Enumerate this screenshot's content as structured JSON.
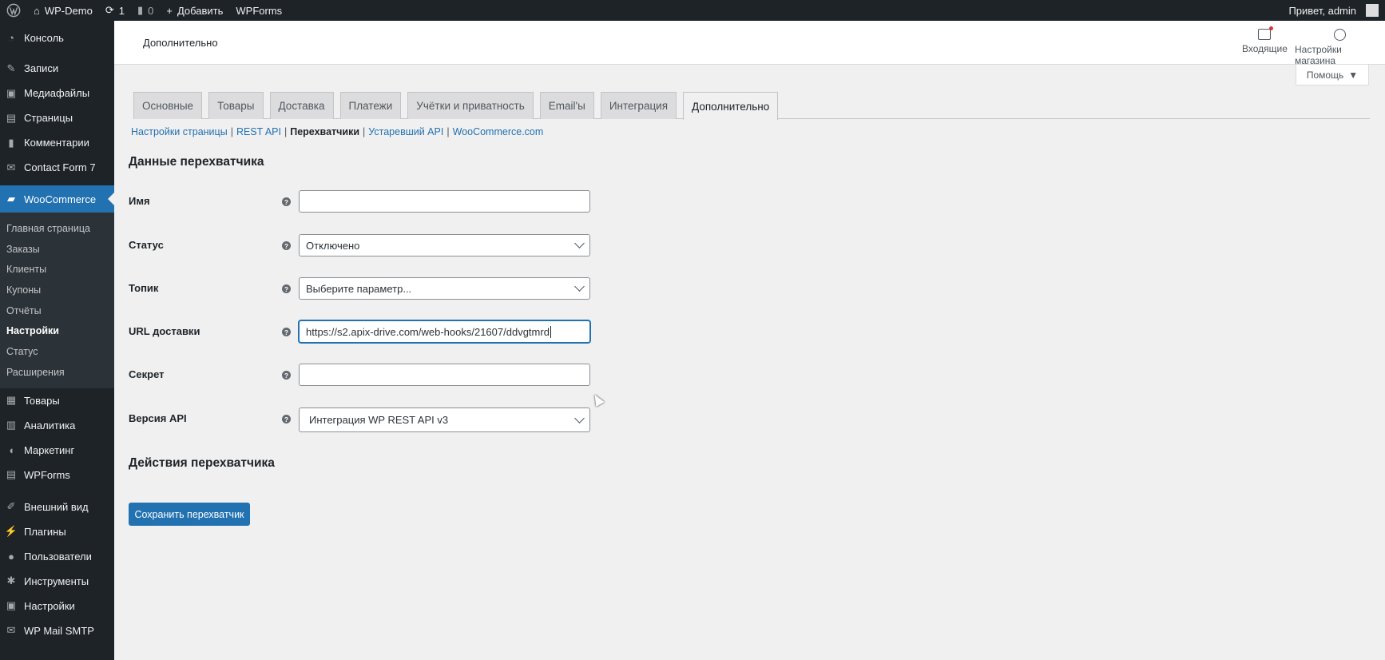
{
  "adminbar": {
    "site_name": "WP-Demo",
    "updates_count": "1",
    "comments_count": "0",
    "add_new": "Добавить",
    "wpforms": "WPForms",
    "greeting": "Привет, admin"
  },
  "sidebar": {
    "items_top": [
      {
        "label": "Консоль",
        "icon": "dashboard-icon"
      },
      {
        "label": "Записи",
        "icon": "pin-icon"
      },
      {
        "label": "Медиафайлы",
        "icon": "media-icon"
      },
      {
        "label": "Страницы",
        "icon": "page-icon"
      },
      {
        "label": "Комментарии",
        "icon": "comment-icon"
      },
      {
        "label": "Contact Form 7",
        "icon": "mail-icon"
      }
    ],
    "active": {
      "label": "WooCommerce",
      "icon": "woo-icon"
    },
    "submenu": [
      "Главная страница",
      "Заказы",
      "Клиенты",
      "Купоны",
      "Отчёты",
      "Настройки",
      "Статус",
      "Расширения"
    ],
    "submenu_current": "Настройки",
    "items_bottom": [
      {
        "label": "Товары",
        "icon": "products-icon"
      },
      {
        "label": "Аналитика",
        "icon": "analytics-icon"
      },
      {
        "label": "Маркетинг",
        "icon": "megaphone-icon"
      },
      {
        "label": "WPForms",
        "icon": "forms-icon"
      },
      {
        "label": "Внешний вид",
        "icon": "brush-icon"
      },
      {
        "label": "Плагины",
        "icon": "plugin-icon"
      },
      {
        "label": "Пользователи",
        "icon": "users-icon"
      },
      {
        "label": "Инструменты",
        "icon": "wrench-icon"
      },
      {
        "label": "Настройки",
        "icon": "settings-icon"
      },
      {
        "label": "WP Mail SMTP",
        "icon": "mail-smtp-icon"
      }
    ]
  },
  "header": {
    "title": "Дополнительно",
    "inbox": "Входящие",
    "store_settings": "Настройки магазина",
    "help": "Помощь"
  },
  "tabs": [
    "Основные",
    "Товары",
    "Доставка",
    "Платежи",
    "Учётки и приватность",
    "Email'ы",
    "Интеграция",
    "Дополнительно"
  ],
  "active_tab": "Дополнительно",
  "sublinks": {
    "page_settings": "Настройки страницы",
    "rest_api": "REST API",
    "webhooks": "Перехватчики",
    "legacy_api": "Устаревший API",
    "woocommerce_com": "WooCommerce.com"
  },
  "form": {
    "section_title": "Данные перехватчика",
    "name_label": "Имя",
    "name_value": "",
    "status_label": "Статус",
    "status_value": "Отключено",
    "topic_label": "Топик",
    "topic_value": "Выберите параметр...",
    "url_label": "URL доставки",
    "url_value": "https://s2.apix-drive.com/web-hooks/21607/ddvgtmrd",
    "secret_label": "Секрет",
    "secret_value": "",
    "api_label": "Версия API",
    "api_value": "Интеграция WP REST API v3",
    "actions_title": "Действия перехватчика",
    "save_button": "Сохранить перехватчик"
  }
}
